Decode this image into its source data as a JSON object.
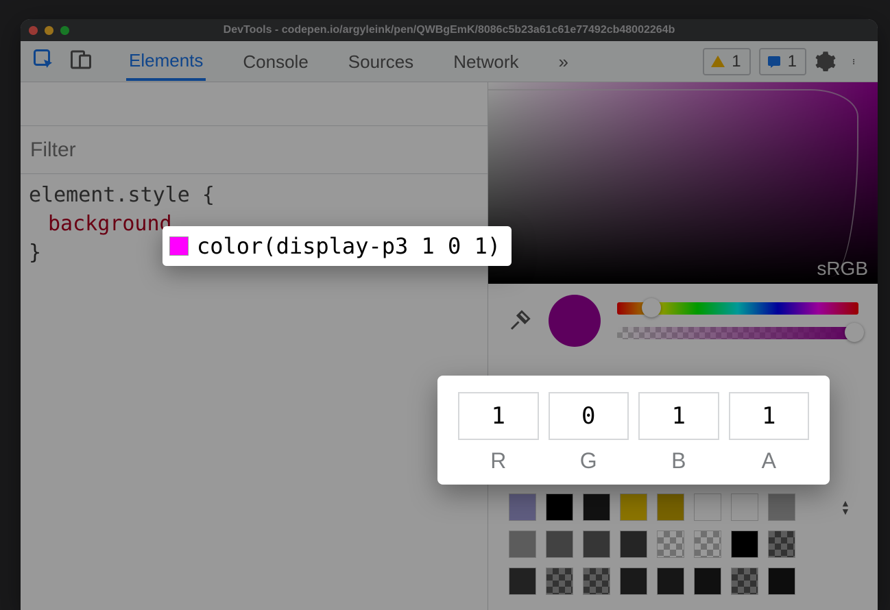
{
  "window": {
    "title": "DevTools - codepen.io/argyleink/pen/QWBgEmK/8086c5b23a61c61e77492cb48002264b"
  },
  "toolbar": {
    "tabs": [
      "Elements",
      "Console",
      "Sources",
      "Network"
    ],
    "active_tab_index": 0,
    "overflow_glyph": "»",
    "warning_count": "1",
    "issues_count": "1"
  },
  "styles": {
    "filter_placeholder": "Filter",
    "selector": "element.style {",
    "property": "background",
    "close": "}"
  },
  "color_value": {
    "swatch_hex": "#ff00ff",
    "text": "color(display-p3 1 0 1)"
  },
  "picker": {
    "gamut_label": "sRGB",
    "current_hex": "#9b009b",
    "channels": [
      {
        "label": "R",
        "value": "1"
      },
      {
        "label": "G",
        "value": "0"
      },
      {
        "label": "B",
        "value": "1"
      },
      {
        "label": "A",
        "value": "1"
      }
    ],
    "palette": {
      "row1": [
        "#9e9bd6",
        "#000000",
        "#1f1f1f",
        "#e8c100",
        "#c8a600",
        "#ffffff",
        "#ffffff",
        "#a6a6a6"
      ],
      "row2": [
        "#9a9a9a",
        "#6f6f6f",
        "#5a5a5a",
        "#3e3e3e",
        "checker",
        "checker",
        "#000000",
        "checker-dark"
      ],
      "row3": [
        "#3a3a3a",
        "checker-dark",
        "checker-dark",
        "#2c2c2c",
        "#262626",
        "#1c1c1c",
        "checker-dark",
        "#161616"
      ]
    }
  }
}
